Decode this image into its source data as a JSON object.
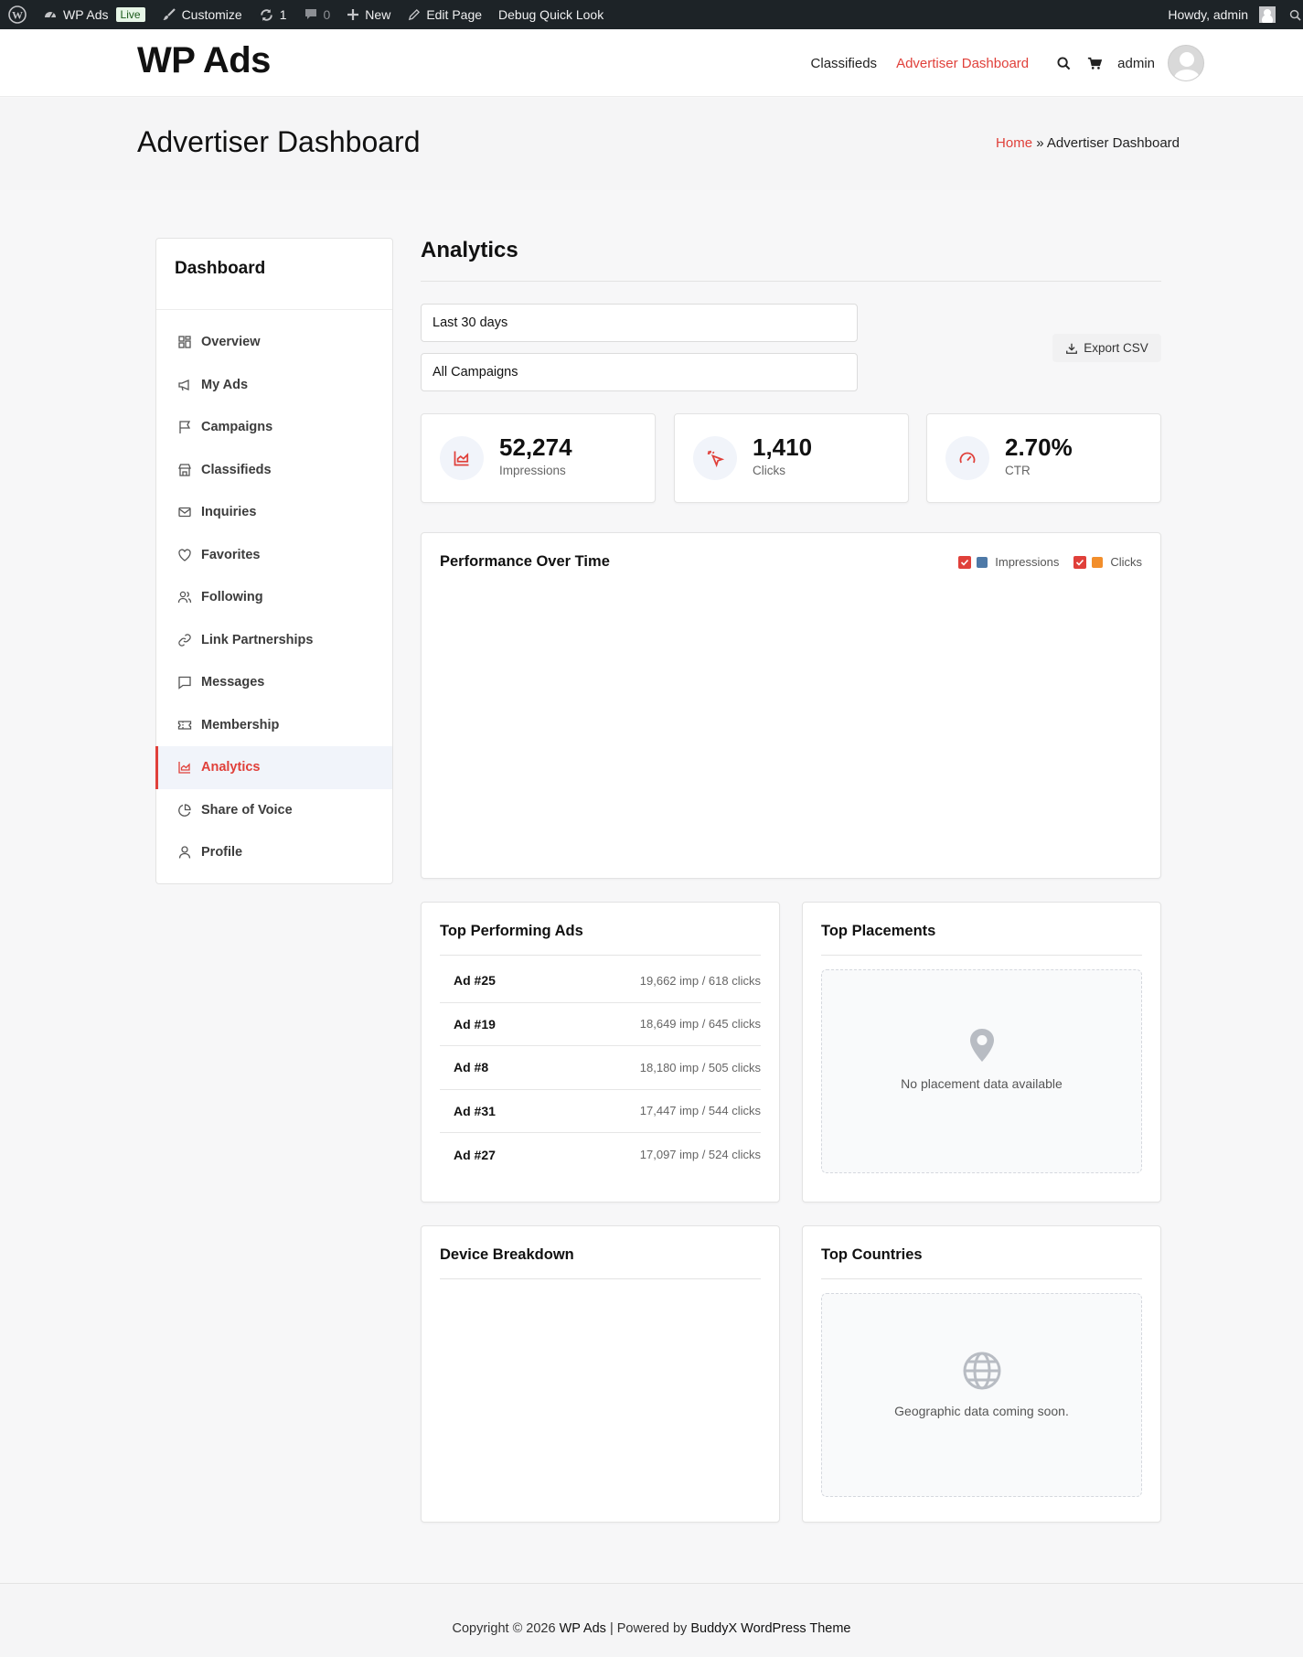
{
  "adminbar": {
    "site_name": "WP Ads",
    "live_badge": "Live",
    "customize": "Customize",
    "updates_count": "1",
    "comments_count": "0",
    "new": "New",
    "edit_page": "Edit Page",
    "debug": "Debug Quick Look",
    "greeting": "Howdy, admin"
  },
  "header": {
    "site_title": "WP Ads",
    "nav": [
      {
        "label": "Classifieds"
      },
      {
        "label": "Advertiser Dashboard"
      }
    ],
    "user": "admin"
  },
  "page": {
    "title": "Advertiser Dashboard",
    "breadcrumb_home": "Home",
    "breadcrumb_sep": "»",
    "breadcrumb_current": "Advertiser Dashboard"
  },
  "sidebar": {
    "title": "Dashboard",
    "items": [
      {
        "label": "Overview"
      },
      {
        "label": "My Ads"
      },
      {
        "label": "Campaigns"
      },
      {
        "label": "Classifieds"
      },
      {
        "label": "Inquiries"
      },
      {
        "label": "Favorites"
      },
      {
        "label": "Following"
      },
      {
        "label": "Link Partnerships"
      },
      {
        "label": "Messages"
      },
      {
        "label": "Membership"
      },
      {
        "label": "Analytics"
      },
      {
        "label": "Share of Voice"
      },
      {
        "label": "Profile"
      }
    ]
  },
  "main": {
    "title": "Analytics",
    "date_range": "Last 30 days",
    "campaign_filter": "All Campaigns",
    "export_label": "Export CSV",
    "stats": [
      {
        "value": "52,274",
        "label": "Impressions"
      },
      {
        "value": "1,410",
        "label": "Clicks"
      },
      {
        "value": "2.70%",
        "label": "CTR"
      }
    ],
    "performance": {
      "title": "Performance Over Time",
      "legend": [
        {
          "label": "Impressions",
          "color": "#4e79a7"
        },
        {
          "label": "Clicks",
          "color": "#f28e2b"
        }
      ]
    },
    "top_ads": {
      "title": "Top Performing Ads",
      "rows": [
        {
          "name": "Ad #25",
          "stat": "19,662 imp / 618 clicks"
        },
        {
          "name": "Ad #19",
          "stat": "18,649 imp / 645 clicks"
        },
        {
          "name": "Ad #8",
          "stat": "18,180 imp / 505 clicks"
        },
        {
          "name": "Ad #31",
          "stat": "17,447 imp / 544 clicks"
        },
        {
          "name": "Ad #27",
          "stat": "17,097 imp / 524 clicks"
        }
      ]
    },
    "top_placements": {
      "title": "Top Placements",
      "empty_text": "No placement data available"
    },
    "device_breakdown": {
      "title": "Device Breakdown"
    },
    "top_countries": {
      "title": "Top Countries",
      "empty_text": "Geographic data coming soon."
    }
  },
  "footer": {
    "prefix": "Copyright © 2026",
    "site": "WP Ads",
    "sep": "| Powered by",
    "theme": "BuddyX WordPress Theme"
  },
  "colors": {
    "accent": "#e0403a",
    "adminbar_bg": "#1d2327"
  }
}
